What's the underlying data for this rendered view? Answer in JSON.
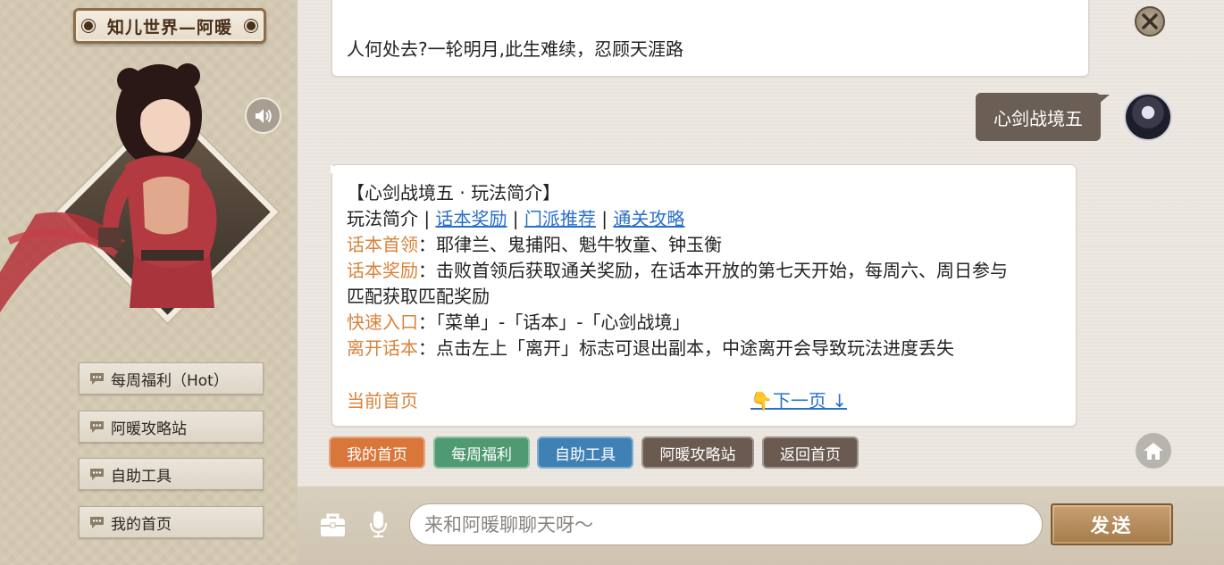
{
  "header": {
    "title": "知儿世界—阿暖"
  },
  "sidebar": {
    "items": [
      {
        "label": "每周福利（Hot）"
      },
      {
        "label": "阿暖攻略站"
      },
      {
        "label": "自助工具"
      },
      {
        "label": "我的首页"
      }
    ]
  },
  "chat": {
    "top_message": "人何处去?一轮明月,此生难续，忍顾天涯路",
    "user_message": "心剑战境五",
    "main_message": {
      "title": "【心剑战境五 · 玩法简介】",
      "nav_current": "玩法简介",
      "nav_sep": " | ",
      "nav_links": [
        "话本奖励",
        "门派推荐",
        "通关攻略"
      ],
      "rows": [
        {
          "label": "话本首领",
          "colon": "：",
          "text": "耶律兰、鬼捕阳、魁牛牧童、钟玉衡"
        },
        {
          "label": "话本奖励",
          "colon": "：",
          "text": "击败首领后获取通关奖励，在话本开放的第七天开始，每周六、周日参与"
        },
        {
          "label": "",
          "colon": "",
          "text": "匹配获取匹配奖励"
        },
        {
          "label": "快速入口",
          "colon": "：",
          "text": "「菜单」-「话本」-「心剑战境」"
        },
        {
          "label": "离开话本",
          "colon": "：",
          "text": "点击左上「离开」标志可退出副本，中途离开会导致玩法进度丢失"
        }
      ],
      "footer_left": "当前首页",
      "footer_right": "👇下一页 ↓"
    }
  },
  "quick_buttons": [
    {
      "label": "我的首页",
      "color": "#d9763a"
    },
    {
      "label": "每周福利",
      "color": "#4f9a72"
    },
    {
      "label": "自助工具",
      "color": "#3f80b5"
    },
    {
      "label": "阿暖攻略站",
      "color": "#6a5a50"
    },
    {
      "label": "返回首页",
      "color": "#6a5a50"
    }
  ],
  "input": {
    "placeholder": "来和阿暖聊聊天呀～",
    "send_label": "发送"
  },
  "icons": {
    "close": "close-icon",
    "speaker": "speaker-icon",
    "home": "home-icon",
    "bag": "briefcase-icon",
    "mic": "microphone-icon",
    "bubble": "speech-bubble-icon"
  }
}
